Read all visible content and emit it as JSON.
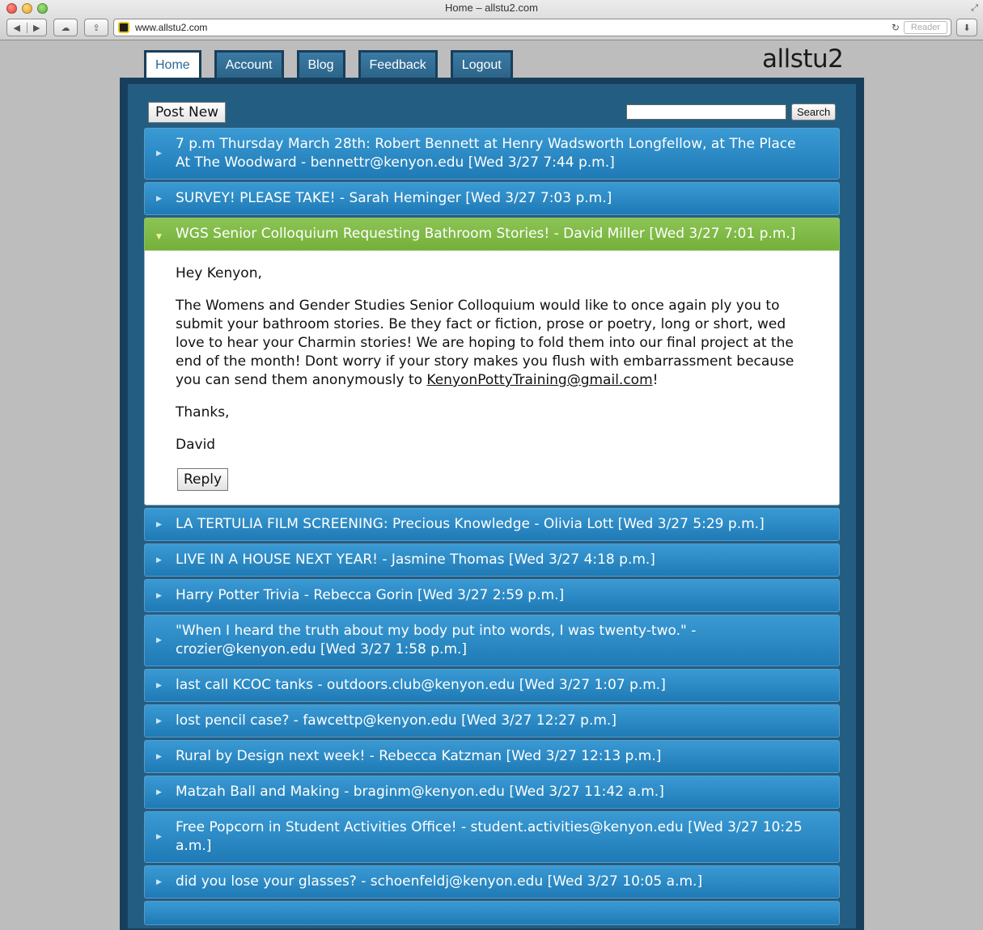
{
  "browser": {
    "title": "Home – allstu2.com",
    "url": "www.allstu2.com",
    "reader_label": "Reader"
  },
  "nav": {
    "tabs": [
      {
        "label": "Home"
      },
      {
        "label": "Account"
      },
      {
        "label": "Blog"
      },
      {
        "label": "Feedback"
      },
      {
        "label": "Logout"
      }
    ],
    "logo": "allstu2"
  },
  "toolbar": {
    "post_new_label": "Post New",
    "search_label": "Search",
    "search_value": ""
  },
  "posts": [
    {
      "title": "7 p.m Thursday March 28th: Robert Bennett at Henry Wadsworth Longfellow, at The Place At The Woodward - bennettr@kenyon.edu [Wed 3/27 7:44 p.m.]"
    },
    {
      "title": "SURVEY! PLEASE TAKE! - Sarah Heminger [Wed 3/27 7:03 p.m.]"
    },
    {
      "title": "WGS Senior Colloquium Requesting Bathroom Stories! - David Miller [Wed 3/27 7:01 p.m.]"
    },
    {
      "title": "LA TERTULIA FILM SCREENING: Precious Knowledge - Olivia Lott [Wed 3/27 5:29 p.m.]"
    },
    {
      "title": "LIVE IN A HOUSE NEXT YEAR! - Jasmine Thomas [Wed 3/27 4:18 p.m.]"
    },
    {
      "title": "Harry Potter Trivia - Rebecca Gorin [Wed 3/27 2:59 p.m.]"
    },
    {
      "title": "\"When I heard the truth about my body put into words, I was twenty-two.\" - crozier@kenyon.edu [Wed 3/27 1:58 p.m.]"
    },
    {
      "title": "last call KCOC tanks - outdoors.club@kenyon.edu [Wed 3/27 1:07 p.m.]"
    },
    {
      "title": "lost pencil case? - fawcettp@kenyon.edu [Wed 3/27 12:27 p.m.]"
    },
    {
      "title": "Rural by Design next week! - Rebecca Katzman [Wed 3/27 12:13 p.m.]"
    },
    {
      "title": "Matzah Ball and Making - braginm@kenyon.edu [Wed 3/27 11:42 a.m.]"
    },
    {
      "title": "Free Popcorn in Student Activities Office! - student.activities@kenyon.edu [Wed 3/27 10:25 a.m.]"
    },
    {
      "title": "did you lose your glasses? - schoenfeldj@kenyon.edu [Wed 3/27 10:05 a.m.]"
    }
  ],
  "open_post": {
    "greeting": "Hey Kenyon,",
    "body": "The Womens and Gender Studies Senior Colloquium would like to once again ply you to submit your bathroom stories. Be they fact or fiction, prose or poetry, long or short, wed love to hear your Charmin stories! We are hoping to fold them into our final project at the end of the month! Dont worry if your story makes you flush with embarrassment because you can send them anonymously to",
    "email": "KenyonPottyTraining@gmail.com",
    "email_suffix": "!",
    "closing": "Thanks,",
    "signature": "David",
    "reply_label": "Reply"
  }
}
